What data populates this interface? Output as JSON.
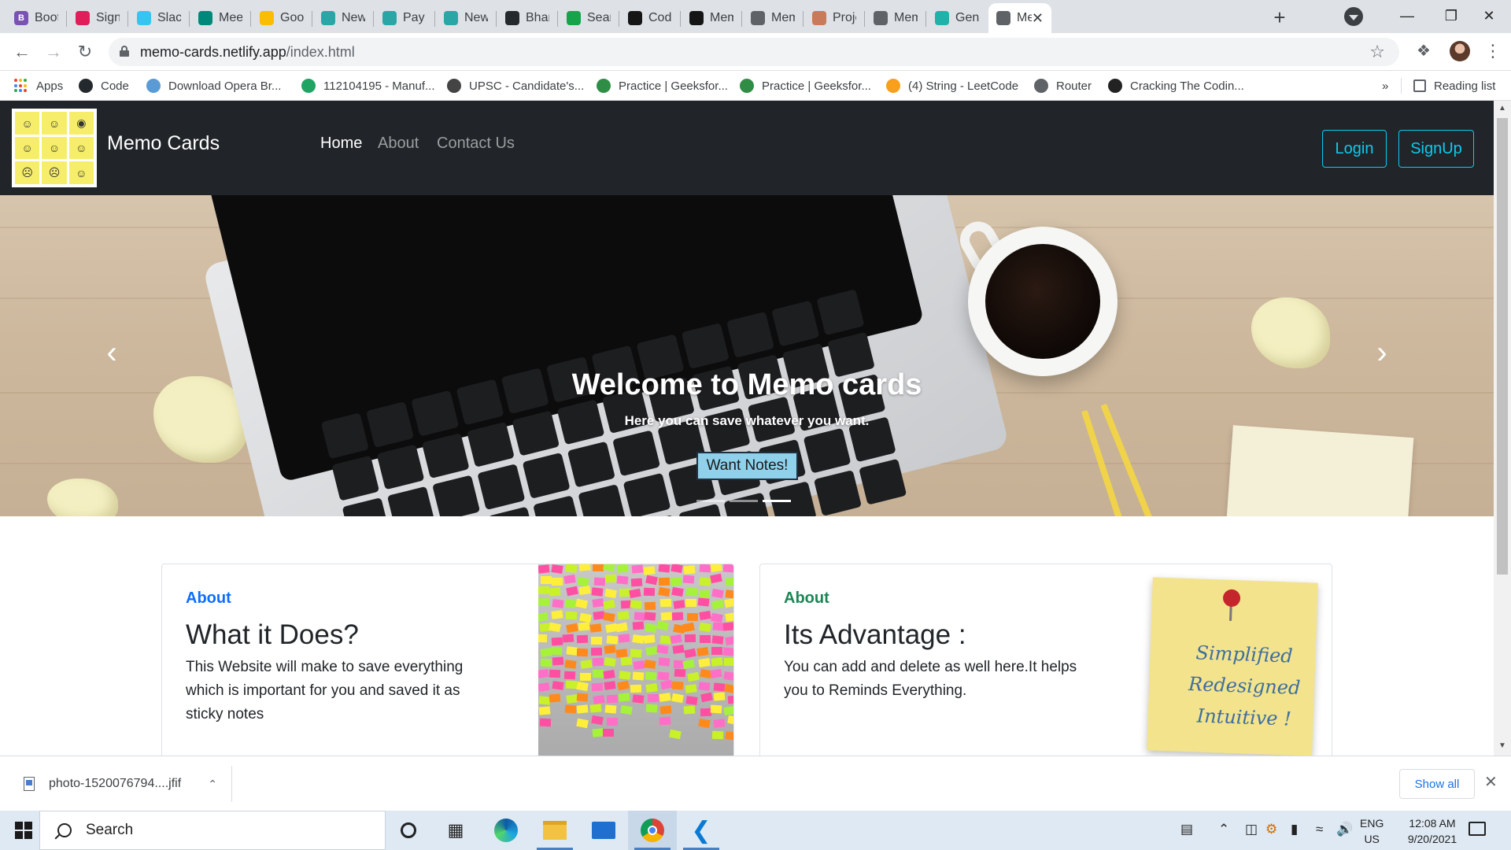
{
  "browser": {
    "tabs": [
      {
        "label": "Bootst",
        "icon": "bootstrap-icon",
        "color": "#7952b3",
        "glyph": "B"
      },
      {
        "label": "Sign ir",
        "icon": "slack-icon",
        "color": "#e01e5a",
        "glyph": ""
      },
      {
        "label": "Slack |",
        "icon": "slack-icon",
        "color": "#36c5f0",
        "glyph": ""
      },
      {
        "label": "Meet -",
        "icon": "meet-icon",
        "color": "#00897b",
        "glyph": ""
      },
      {
        "label": "Googl",
        "icon": "google-keep-icon",
        "color": "#fbbc04",
        "glyph": ""
      },
      {
        "label": "Newto",
        "icon": "newton-icon",
        "color": "#2aa6a6",
        "glyph": ""
      },
      {
        "label": "Pay aft",
        "icon": "newton-icon",
        "color": "#2aa6a6",
        "glyph": ""
      },
      {
        "label": "Newto",
        "icon": "newton-icon",
        "color": "#2aa6a6",
        "glyph": ""
      },
      {
        "label": "Bhartir",
        "icon": "github-icon",
        "color": "#24292e",
        "glyph": ""
      },
      {
        "label": "Search",
        "icon": "vercel-icon",
        "color": "#16a34a",
        "glyph": ""
      },
      {
        "label": "CodeS",
        "icon": "codesandbox-icon",
        "color": "#151515",
        "glyph": ""
      },
      {
        "label": "Memo",
        "icon": "codesandbox-icon",
        "color": "#151515",
        "glyph": ""
      },
      {
        "label": "Memo",
        "icon": "globe-icon",
        "color": "#5f6368",
        "glyph": ""
      },
      {
        "label": "Projec",
        "icon": "avatar-icon",
        "color": "#c97a5a",
        "glyph": ""
      },
      {
        "label": "Memo",
        "icon": "globe-icon",
        "color": "#5f6368",
        "glyph": ""
      },
      {
        "label": "Gener",
        "icon": "netlify-icon",
        "color": "#20b2aa",
        "glyph": ""
      },
      {
        "label": "Me",
        "icon": "globe-icon",
        "color": "#5f6368",
        "glyph": "",
        "active": true
      }
    ],
    "url_host": "memo-cards.netlify.app",
    "url_path": "/index.html",
    "bookmarks": [
      {
        "label": "Apps",
        "icon": "apps-grid-icon"
      },
      {
        "label": "Code",
        "icon": "github-icon"
      },
      {
        "label": "Download Opera Br...",
        "icon": "opera-icon"
      },
      {
        "label": "112104195 - Manuf...",
        "icon": "google-drive-icon"
      },
      {
        "label": "UPSC - Candidate's...",
        "icon": "emblem-icon"
      },
      {
        "label": "Practice | Geeksfor...",
        "icon": "geeksforgeeks-icon"
      },
      {
        "label": "Practice | Geeksfor...",
        "icon": "geeksforgeeks-icon"
      },
      {
        "label": "(4) String - LeetCode",
        "icon": "leetcode-icon"
      },
      {
        "label": "Router",
        "icon": "globe-icon"
      },
      {
        "label": "Cracking The Codin...",
        "icon": "book-icon"
      }
    ],
    "overflow_label": "»",
    "reading_list": "Reading list"
  },
  "site": {
    "brand": "Memo Cards",
    "nav": [
      {
        "label": "Home",
        "active": true
      },
      {
        "label": "About",
        "active": false
      },
      {
        "label": "Contact Us",
        "active": false
      }
    ],
    "login_label": "Login",
    "signup_label": "SignUp",
    "accent_color": "#0dcaf0",
    "hero": {
      "title": "Welcome to Memo cards",
      "subtitle": "Here you can save whatever you want.",
      "button": "Want Notes!",
      "slides": 3,
      "active_slide": 3,
      "prev_icon": "chevron-left-icon",
      "next_icon": "chevron-right-icon"
    },
    "cards": [
      {
        "eyebrow": "About",
        "eyebrow_color": "#0d6efd",
        "title": "What it Does?",
        "text": "This Website will make to save everything which is important for you and saved it as sticky notes"
      },
      {
        "eyebrow": "About",
        "eyebrow_color": "#198754",
        "title": "Its Advantage :",
        "text": "You can add and delete as well here.It helps you to Reminds Everything.",
        "image_text": [
          "Simplified",
          "Redesigned",
          "Intuitive !"
        ]
      }
    ]
  },
  "downloads": {
    "file": "photo-1520076794....jfif",
    "show_all": "Show all"
  },
  "taskbar": {
    "search_placeholder": "Search",
    "lang_line1": "ENG",
    "lang_line2": "US",
    "time": "12:08 AM",
    "date": "9/20/2021"
  }
}
